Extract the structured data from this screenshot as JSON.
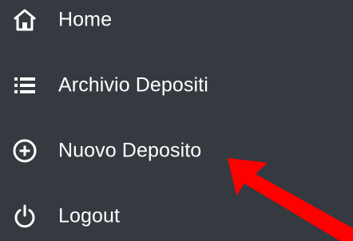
{
  "sidebar": {
    "items": [
      {
        "label": "Home",
        "icon": "home-icon"
      },
      {
        "label": "Archivio Depositi",
        "icon": "list-icon"
      },
      {
        "label": "Nuovo Deposito",
        "icon": "plus-circle-icon"
      },
      {
        "label": "Logout",
        "icon": "power-icon"
      }
    ]
  },
  "colors": {
    "background": "#343a40",
    "text": "#ffffff",
    "annotation_arrow": "#ff0000"
  }
}
